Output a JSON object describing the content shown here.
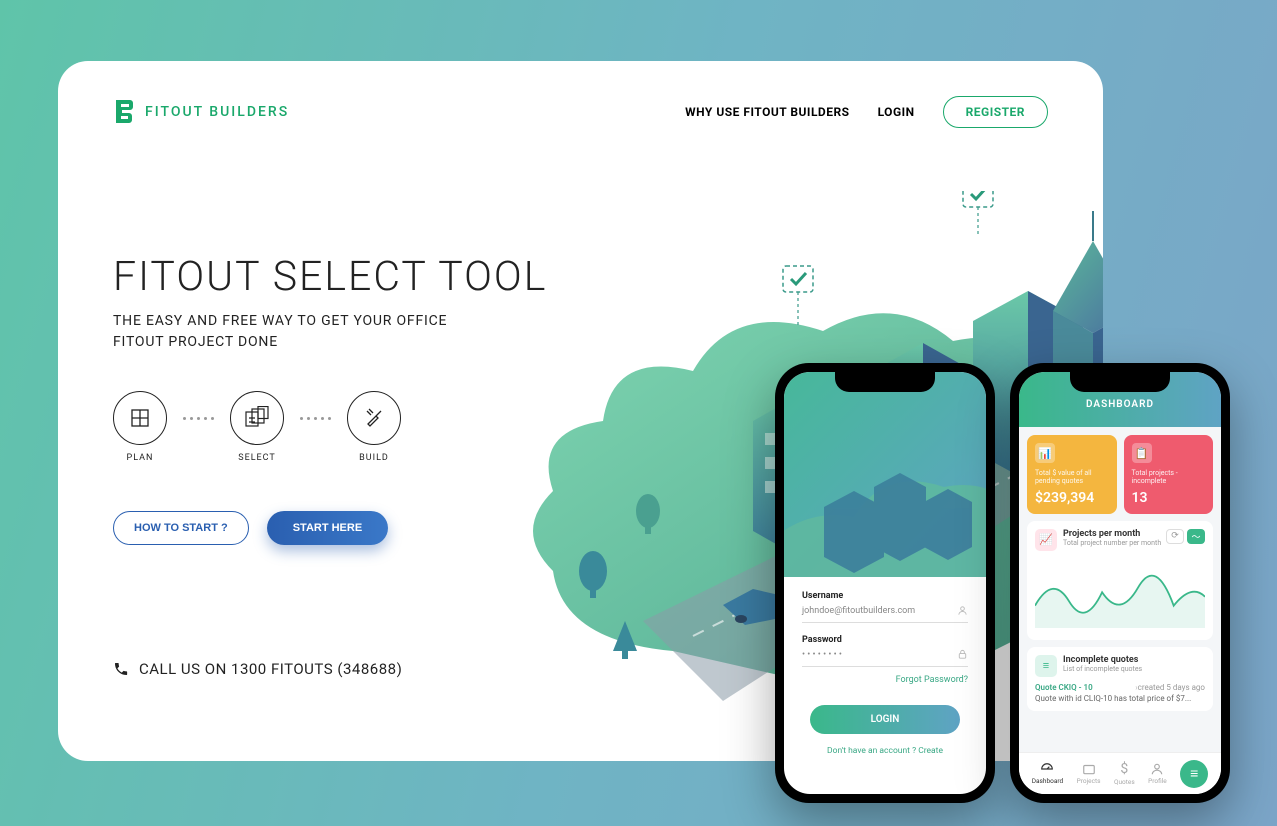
{
  "brand": {
    "name": "FITOUT BUILDERS"
  },
  "nav": {
    "why": "WHY USE FITOUT BUILDERS",
    "login": "LOGIN",
    "register": "REGISTER"
  },
  "hero": {
    "title": "FITOUT SELECT TOOL",
    "subtitle": "THE EASY AND FREE WAY TO GET YOUR  OFFICE FITOUT PROJECT DONE"
  },
  "steps": {
    "plan": "PLAN",
    "select": "SELECT",
    "build": "BUILD"
  },
  "cta": {
    "how": "HOW TO START ?",
    "start": "START HERE"
  },
  "call": {
    "text": "CALL US ON 1300 FITOUTS (348688)"
  },
  "phone1": {
    "username_label": "Username",
    "username_value": "johndoe@fitoutbuilders.com",
    "password_label": "Password",
    "password_value": "• • • • • • • •",
    "forgot": "Forgot Password?",
    "login_btn": "LOGIN",
    "noacct": "Don't have an account ? ",
    "create": "Create"
  },
  "phone2": {
    "header": "DASHBOARD",
    "card1": {
      "label": "Total $ value of all pending quotes",
      "value": "$239,394"
    },
    "card2": {
      "label": "Total projects - incomplete",
      "value": "13"
    },
    "chart": {
      "title": "Projects per month",
      "sub": "Total project number per month"
    },
    "incomplete": {
      "title": "Incomplete quotes",
      "sub": "List of incomplete quotes"
    },
    "quote": {
      "name": "Quote CKIQ - 10",
      "time": "created 5 days ago",
      "desc": "Quote with id CLIQ-10 has total price of $7..."
    },
    "tabs": {
      "dashboard": "Dashboard",
      "projects": "Projects",
      "quotes": "Quotes",
      "profile": "Profile"
    }
  }
}
